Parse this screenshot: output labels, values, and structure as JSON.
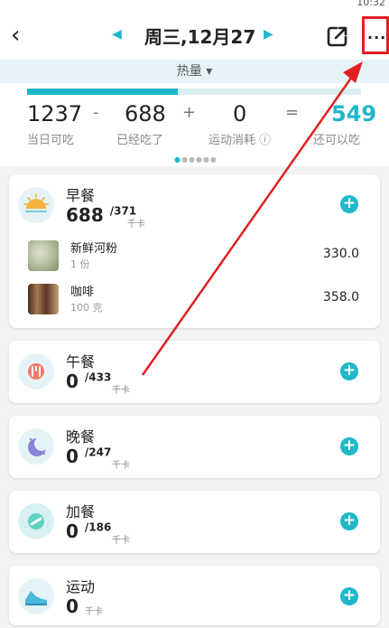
{
  "status": {
    "right_text": "10:32"
  },
  "header": {
    "back_glyph": "‹",
    "prev_glyph": "◀",
    "next_glyph": "▶",
    "date_title": "周三,12月27",
    "more_glyph": "···"
  },
  "metric_selector": {
    "label": "热量 ▾"
  },
  "summary": {
    "progress_ratio": 0.45,
    "items": [
      {
        "value": "1237",
        "label": "当日可吃"
      },
      {
        "value": "688",
        "label": "已经吃了"
      },
      {
        "value": "0",
        "label": "运动消耗 ⓘ"
      },
      {
        "value": "549",
        "label": "还可以吃"
      }
    ],
    "operators": [
      "-",
      "+",
      "="
    ],
    "accent": "#1fb8c9"
  },
  "meals": [
    {
      "name": "早餐",
      "eaten": "688",
      "target": "/371",
      "unit": "千卡",
      "icon": "sunrise-icon",
      "foods": [
        {
          "name": "新鲜河粉",
          "amount": "1 份",
          "calories": "330.0"
        },
        {
          "name": "咖啡",
          "amount": "100 克",
          "calories": "358.0"
        }
      ]
    },
    {
      "name": "午餐",
      "eaten": "0",
      "target": "/433",
      "unit": "千卡",
      "icon": "sun-icon"
    },
    {
      "name": "晚餐",
      "eaten": "0",
      "target": "/247",
      "unit": "千卡",
      "icon": "moon-icon"
    },
    {
      "name": "加餐",
      "eaten": "0",
      "target": "/186",
      "unit": "千卡",
      "icon": "snack-icon"
    },
    {
      "name": "运动",
      "eaten": "0",
      "target": "",
      "unit": "千卡",
      "icon": "shoe-icon"
    }
  ],
  "add_glyph": "+"
}
